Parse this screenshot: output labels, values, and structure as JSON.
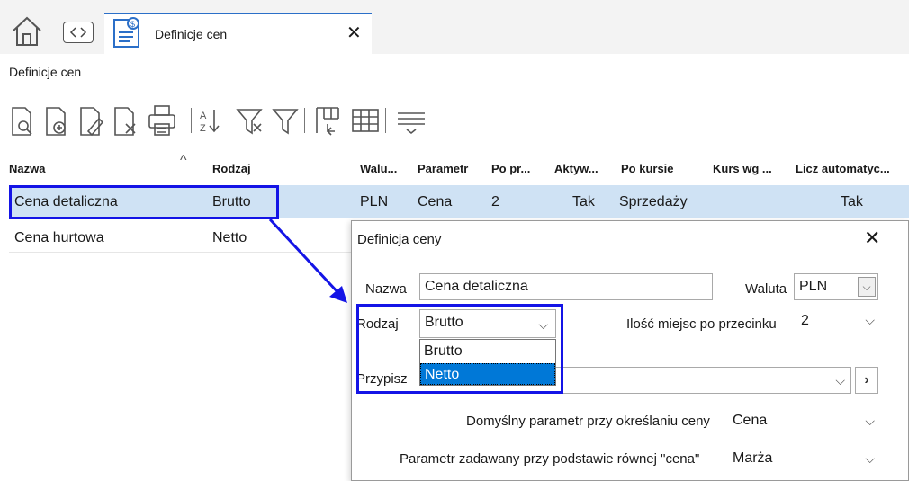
{
  "tabs": {
    "active_label": "Definicje cen"
  },
  "breadcrumb": "Definicje cen",
  "toolbar": {
    "icons": [
      "preview-icon",
      "add-icon",
      "edit-icon",
      "delete-icon",
      "print-icon",
      "sort-az-icon",
      "filter-clear-icon",
      "filter-icon",
      "columns-icon",
      "grid-icon",
      "group-icon"
    ]
  },
  "grid": {
    "columns": [
      "Nazwa",
      "Rodzaj",
      "Walu...",
      "Parametr",
      "Po pr...",
      "Aktyw...",
      "Po kursie",
      "Kurs wg ...",
      "Licz automatyc..."
    ],
    "rows": [
      {
        "nazwa": "Cena detaliczna",
        "rodzaj": "Brutto",
        "waluta": "PLN",
        "parametr": "Cena",
        "po_pr": "2",
        "aktywna": "Tak",
        "po_kursie": "Sprzedaży",
        "kurs_wg": "",
        "licz": "Tak"
      },
      {
        "nazwa": "Cena hurtowa",
        "rodzaj": "Netto"
      }
    ],
    "sort_indicator": "^"
  },
  "dialog": {
    "title": "Definicja ceny",
    "nazwa_label": "Nazwa",
    "nazwa_value": "Cena detaliczna",
    "waluta_label": "Waluta",
    "waluta_value": "PLN",
    "rodzaj_label": "Rodzaj",
    "rodzaj_value": "Brutto",
    "rodzaj_options": [
      "Brutto",
      "Netto"
    ],
    "rodzaj_selected_option": "Netto",
    "miejsc_label": "Ilość miejsc po przecinku",
    "miejsc_value": "2",
    "przypisz_label": "Przypisz",
    "przypisz_value": "",
    "domyslny_label": "Domyślny parametr przy określaniu ceny",
    "domyslny_value": "Cena",
    "podstawa_label": "Parametr zadawany przy podstawie równej \"cena\"",
    "podstawa_value": "Marża"
  },
  "colors": {
    "accent": "#1414e6",
    "selection": "#cfe2f4",
    "list_selected": "#0078d7"
  }
}
